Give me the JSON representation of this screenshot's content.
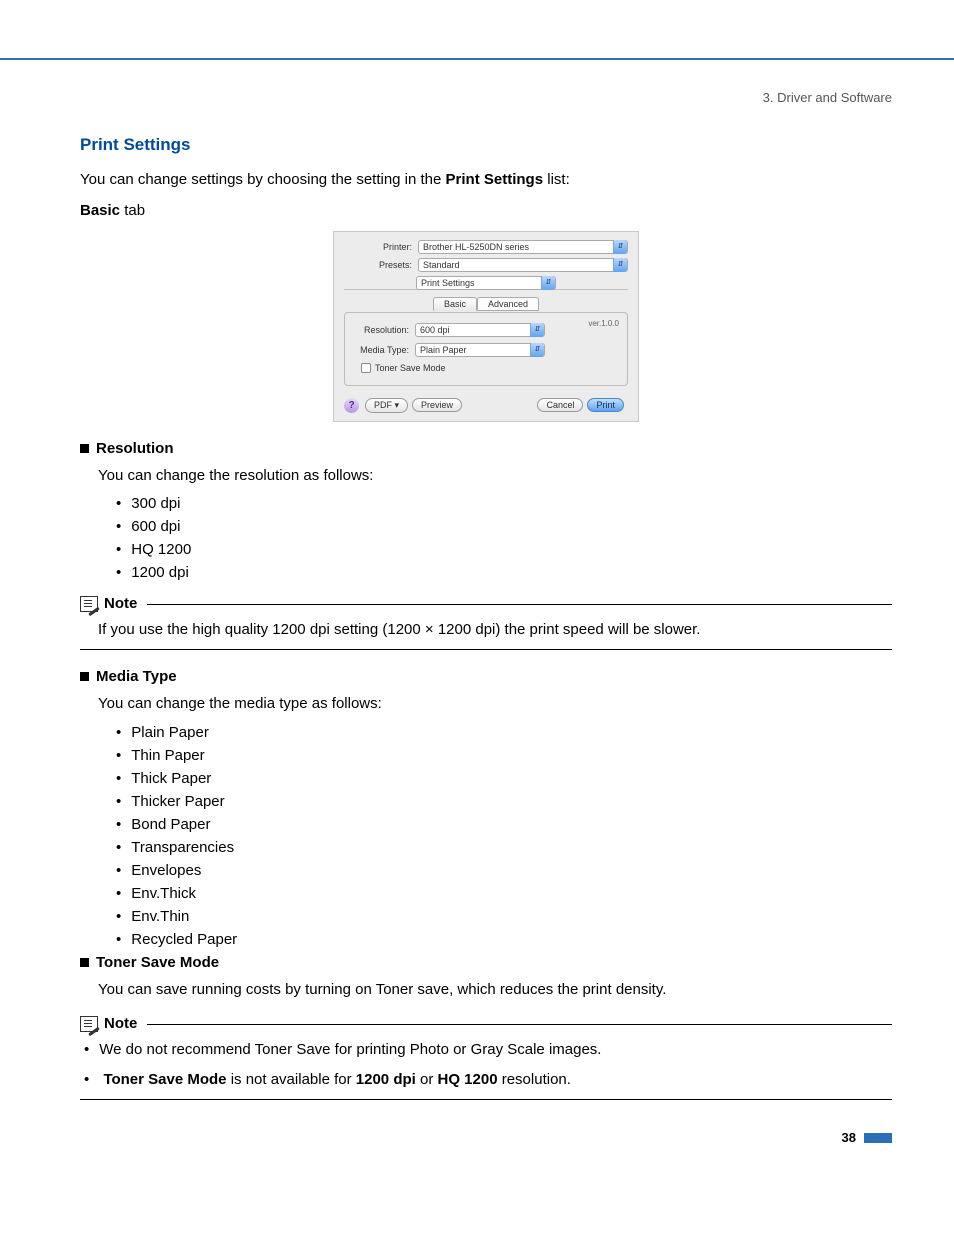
{
  "breadcrumb": "3. Driver and Software",
  "section_title": "Print Settings",
  "intro": {
    "pre": "You can change settings by choosing the setting in the ",
    "bold": "Print Settings",
    "post": " list:"
  },
  "basic_tab_label": {
    "bold": "Basic",
    "post": " tab"
  },
  "dialog": {
    "printer_label": "Printer:",
    "printer_value": "Brother HL-5250DN series",
    "presets_label": "Presets:",
    "presets_value": "Standard",
    "section_value": "Print Settings",
    "tab_basic": "Basic",
    "tab_advanced": "Advanced",
    "version": "ver.1.0.0",
    "resolution_label": "Resolution:",
    "resolution_value": "600 dpi",
    "mediatype_label": "Media Type:",
    "mediatype_value": "Plain Paper",
    "toner_save_label": "Toner Save Mode",
    "help": "?",
    "pdf_btn": "PDF ▾",
    "preview_btn": "Preview",
    "cancel_btn": "Cancel",
    "print_btn": "Print"
  },
  "resolution": {
    "heading": "Resolution",
    "desc": "You can change the resolution as follows:",
    "opts": [
      "300 dpi",
      "600 dpi",
      "HQ 1200",
      "1200 dpi"
    ]
  },
  "note1": {
    "label": "Note",
    "body": "If you use the high quality 1200 dpi setting (1200 × 1200 dpi) the print speed will be slower."
  },
  "mediatype": {
    "heading": "Media Type",
    "desc": "You can change the media type as follows:",
    "opts": [
      "Plain Paper",
      "Thin Paper",
      "Thick Paper",
      "Thicker Paper",
      "Bond Paper",
      "Transparencies",
      "Envelopes",
      "Env.Thick",
      "Env.Thin",
      "Recycled Paper"
    ]
  },
  "toner": {
    "heading": "Toner Save Mode",
    "desc": "You can save running costs by turning on Toner save, which reduces the print density."
  },
  "note2": {
    "label": "Note",
    "line1": "We do not recommend Toner Save for printing Photo or Gray Scale images.",
    "line2": {
      "b1": "Toner Save Mode",
      "t1": " is not available for ",
      "b2": "1200 dpi",
      "t2": " or ",
      "b3": "HQ 1200",
      "t3": " resolution."
    }
  },
  "page_number": "38"
}
